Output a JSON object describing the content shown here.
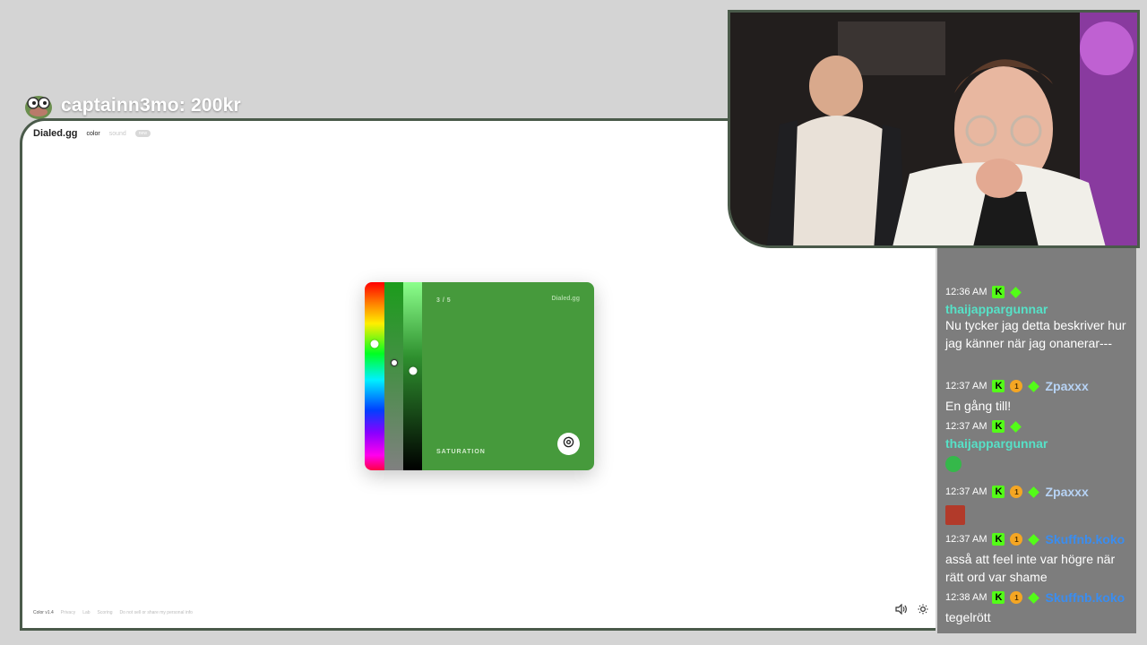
{
  "donation": {
    "text": "captainn3mo: 200kr",
    "avatar_icon": "pepe-frog-glasses-icon"
  },
  "site": {
    "logo": "Dialed.gg",
    "nav": {
      "color": "color",
      "sound": "sound",
      "badge": "new"
    },
    "footer": {
      "version": "Color v1.4",
      "links": [
        "Privacy",
        "Lab",
        "Scoring",
        "Do not sell or share my personal info"
      ]
    },
    "icons": [
      "volume-icon",
      "brightness-icon"
    ]
  },
  "game": {
    "step": "3 / 5",
    "brand": "Dialed.gg",
    "slider_label": "SATURATION",
    "color": "#469a3c",
    "hue_level": 0.33,
    "saturation_level": 0.43,
    "lightness_level": 0.47
  },
  "webcam": {
    "accent": "#b44bc9"
  },
  "chat": {
    "colors": {
      "kick_green": "#53fc18",
      "coin_gold": "#f5a623",
      "teal": "#56e1c7",
      "light_blue": "#b7d3f5",
      "blue": "#3a8df0"
    },
    "messages": [
      {
        "time": "12:36 AM",
        "badges": [
          "kick",
          "gem"
        ],
        "user": "thaijappargunnar",
        "user_color": "#56e1c7",
        "text": "Nu tycker jag detta beskriver hur jag känner när jag onanerar---"
      },
      {
        "time": "12:37 AM",
        "badges": [
          "kick",
          "coin",
          "gem"
        ],
        "user": "Zpaxxx",
        "user_color": "#b7d3f5",
        "text": "En gång till!"
      },
      {
        "time": "12:37 AM",
        "badges": [
          "kick",
          "gem"
        ],
        "user": "thaijappargunnar",
        "user_color": "#56e1c7",
        "text": "",
        "emote": "frog-emote"
      },
      {
        "time": "12:37 AM",
        "badges": [
          "kick",
          "coin",
          "gem"
        ],
        "user": "Zpaxxx",
        "user_color": "#b7d3f5",
        "text": "",
        "emote": "face-emote"
      },
      {
        "time": "12:37 AM",
        "badges": [
          "kick",
          "coin",
          "gem"
        ],
        "user": "Skuffnb.koko",
        "user_color": "#3a8df0",
        "text": "asså att feel inte var högre när rätt ord var shame"
      },
      {
        "time": "12:38 AM",
        "badges": [
          "kick",
          "coin",
          "gem"
        ],
        "user": "Skuffnb.koko",
        "user_color": "#3a8df0",
        "text": "tegelrött"
      }
    ]
  }
}
